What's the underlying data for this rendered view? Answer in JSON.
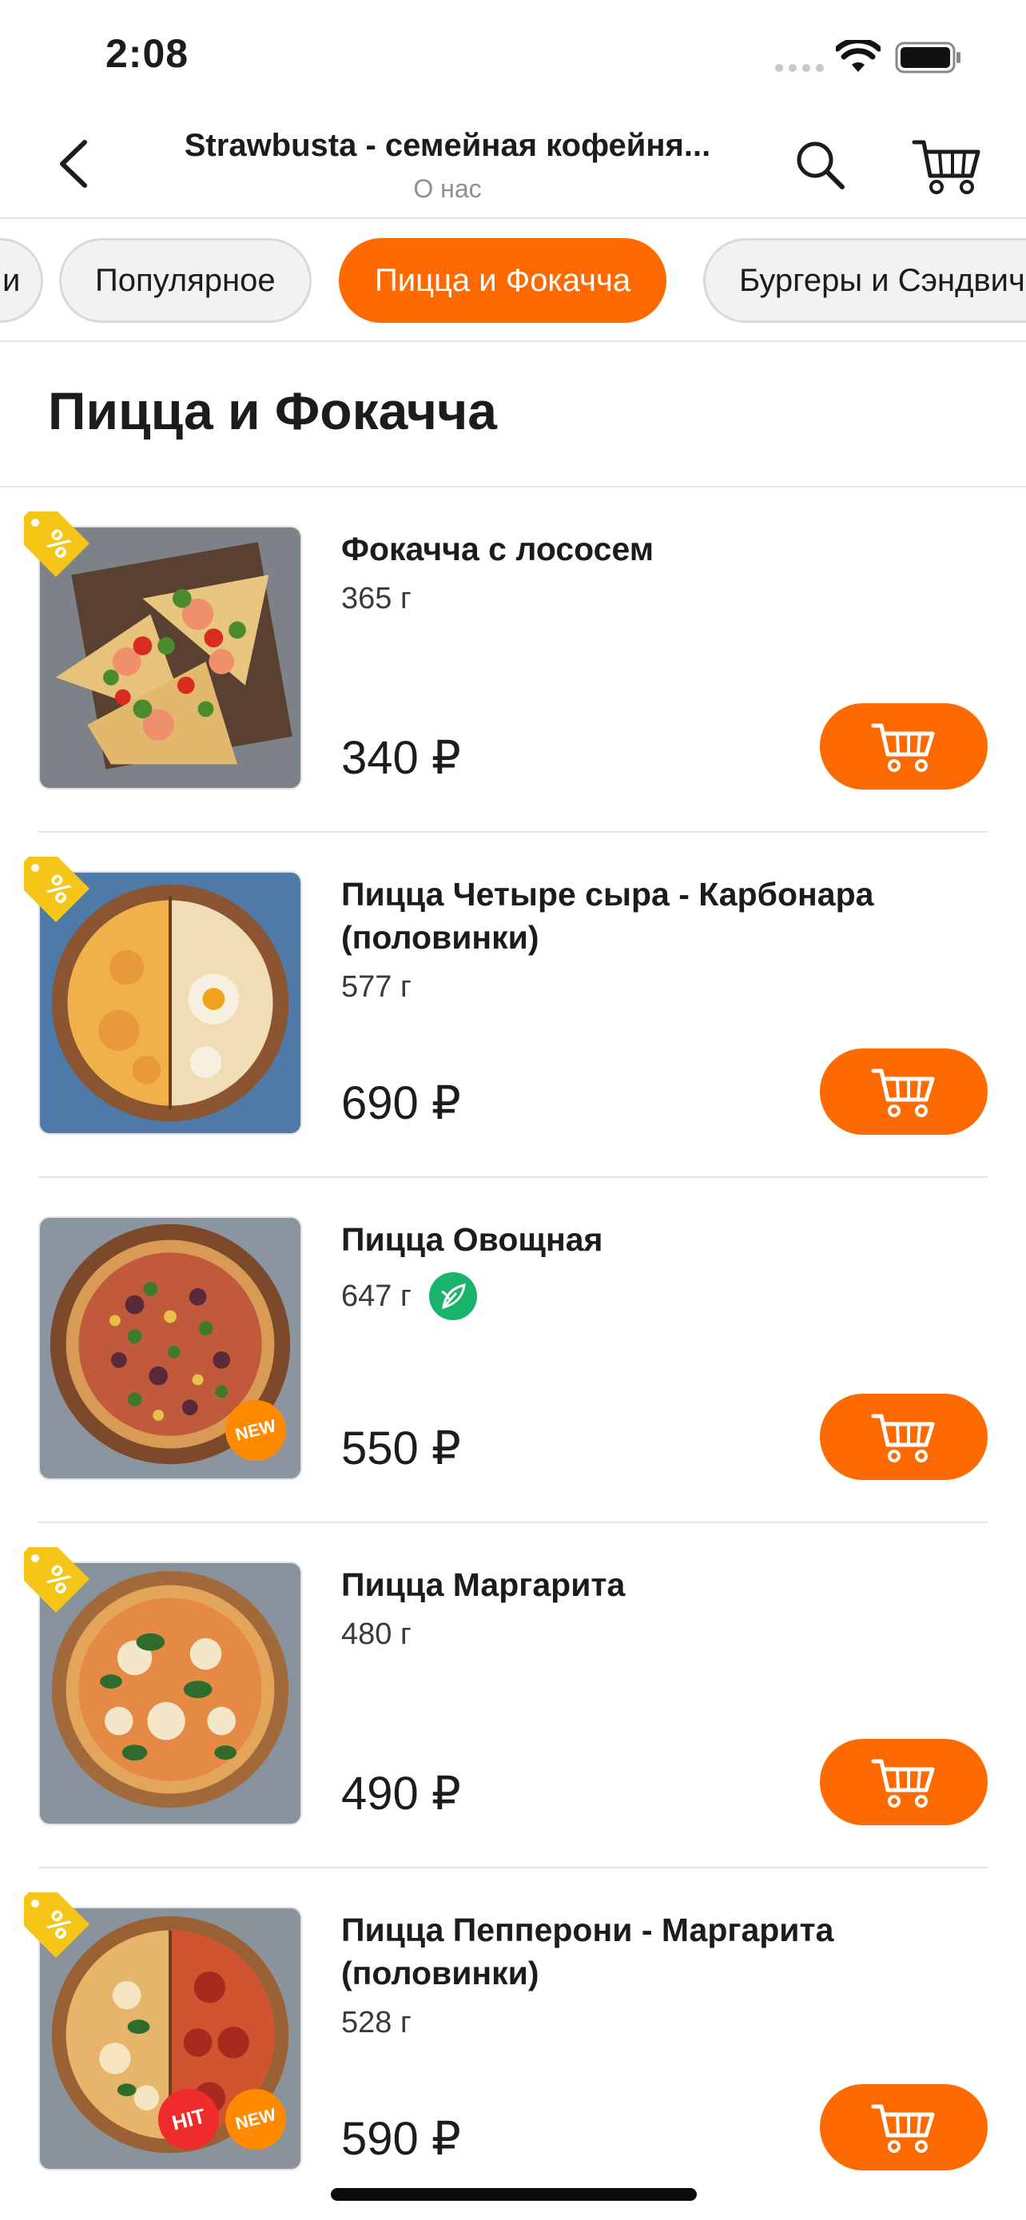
{
  "status_bar": {
    "time": "2:08"
  },
  "header": {
    "title": "Strawbusta - семейная кофейня...",
    "subtitle": "О нас"
  },
  "categories": [
    {
      "label": "и"
    },
    {
      "label": "Популярное"
    },
    {
      "label": "Пицца и Фокачча",
      "active": true
    },
    {
      "label": "Бургеры и Сэндвичи"
    }
  ],
  "section_title": "Пицца и Фокачча",
  "currency": "₽",
  "products": [
    {
      "name": "Фокачча с лососем",
      "weight": "365 г",
      "price": "340 ₽",
      "promo": true,
      "badges": []
    },
    {
      "name": "Пицца Четыре сыра - Карбонара (половинки)",
      "weight": "577 г",
      "price": "690 ₽",
      "promo": true,
      "badges": []
    },
    {
      "name": "Пицца Овощная",
      "weight": "647 г",
      "price": "550 ₽",
      "promo": false,
      "vegetarian": true,
      "badges": [
        "NEW"
      ]
    },
    {
      "name": "Пицца Маргарита",
      "weight": "480 г",
      "price": "490 ₽",
      "promo": true,
      "badges": []
    },
    {
      "name": "Пицца Пепперони - Маргарита (половинки)",
      "weight": "528 г",
      "price": "590 ₽",
      "promo": true,
      "badges": [
        "HIT",
        "NEW"
      ]
    }
  ],
  "colors": {
    "accent": "#ff6a00",
    "promo_tag": "#f5c518",
    "vegetarian": "#19b36b",
    "badge_new": "#ff8a00",
    "badge_hit": "#ef2b2b"
  },
  "icons": {
    "back": "chevron-left-icon",
    "search": "search-icon",
    "cart": "cart-icon",
    "promo": "percent-tag-icon",
    "vegetarian": "leaf-icon"
  }
}
